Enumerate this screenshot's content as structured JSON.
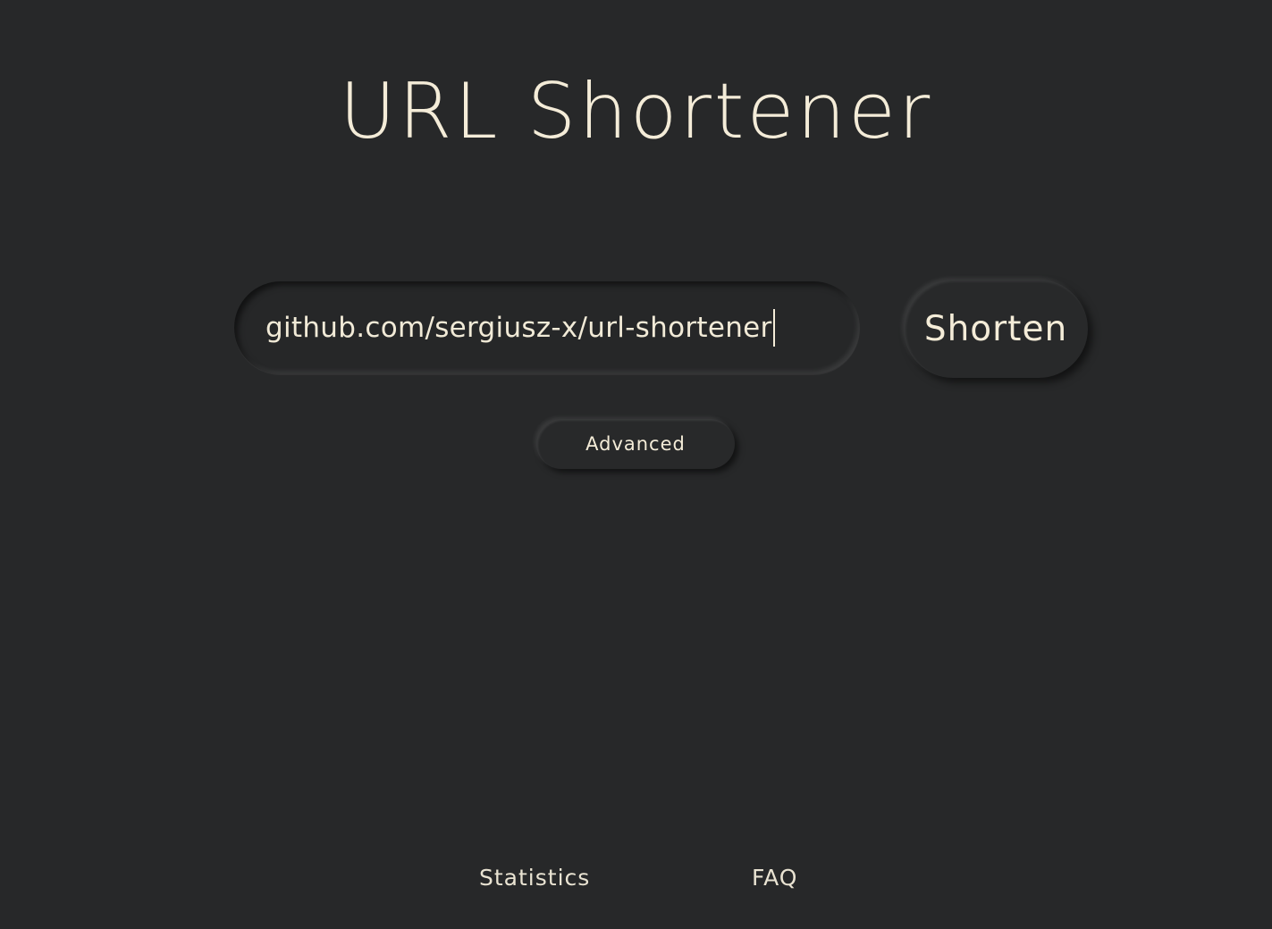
{
  "header": {
    "title": "URL Shortener"
  },
  "form": {
    "url_value": "github.com/sergiusz-x/url-shortener",
    "shorten_label": "Shorten",
    "advanced_label": "Advanced"
  },
  "footer": {
    "links": [
      {
        "label": "Statistics"
      },
      {
        "label": "FAQ"
      }
    ]
  },
  "colors": {
    "background": "#272829",
    "text": "#f4ecd8"
  }
}
